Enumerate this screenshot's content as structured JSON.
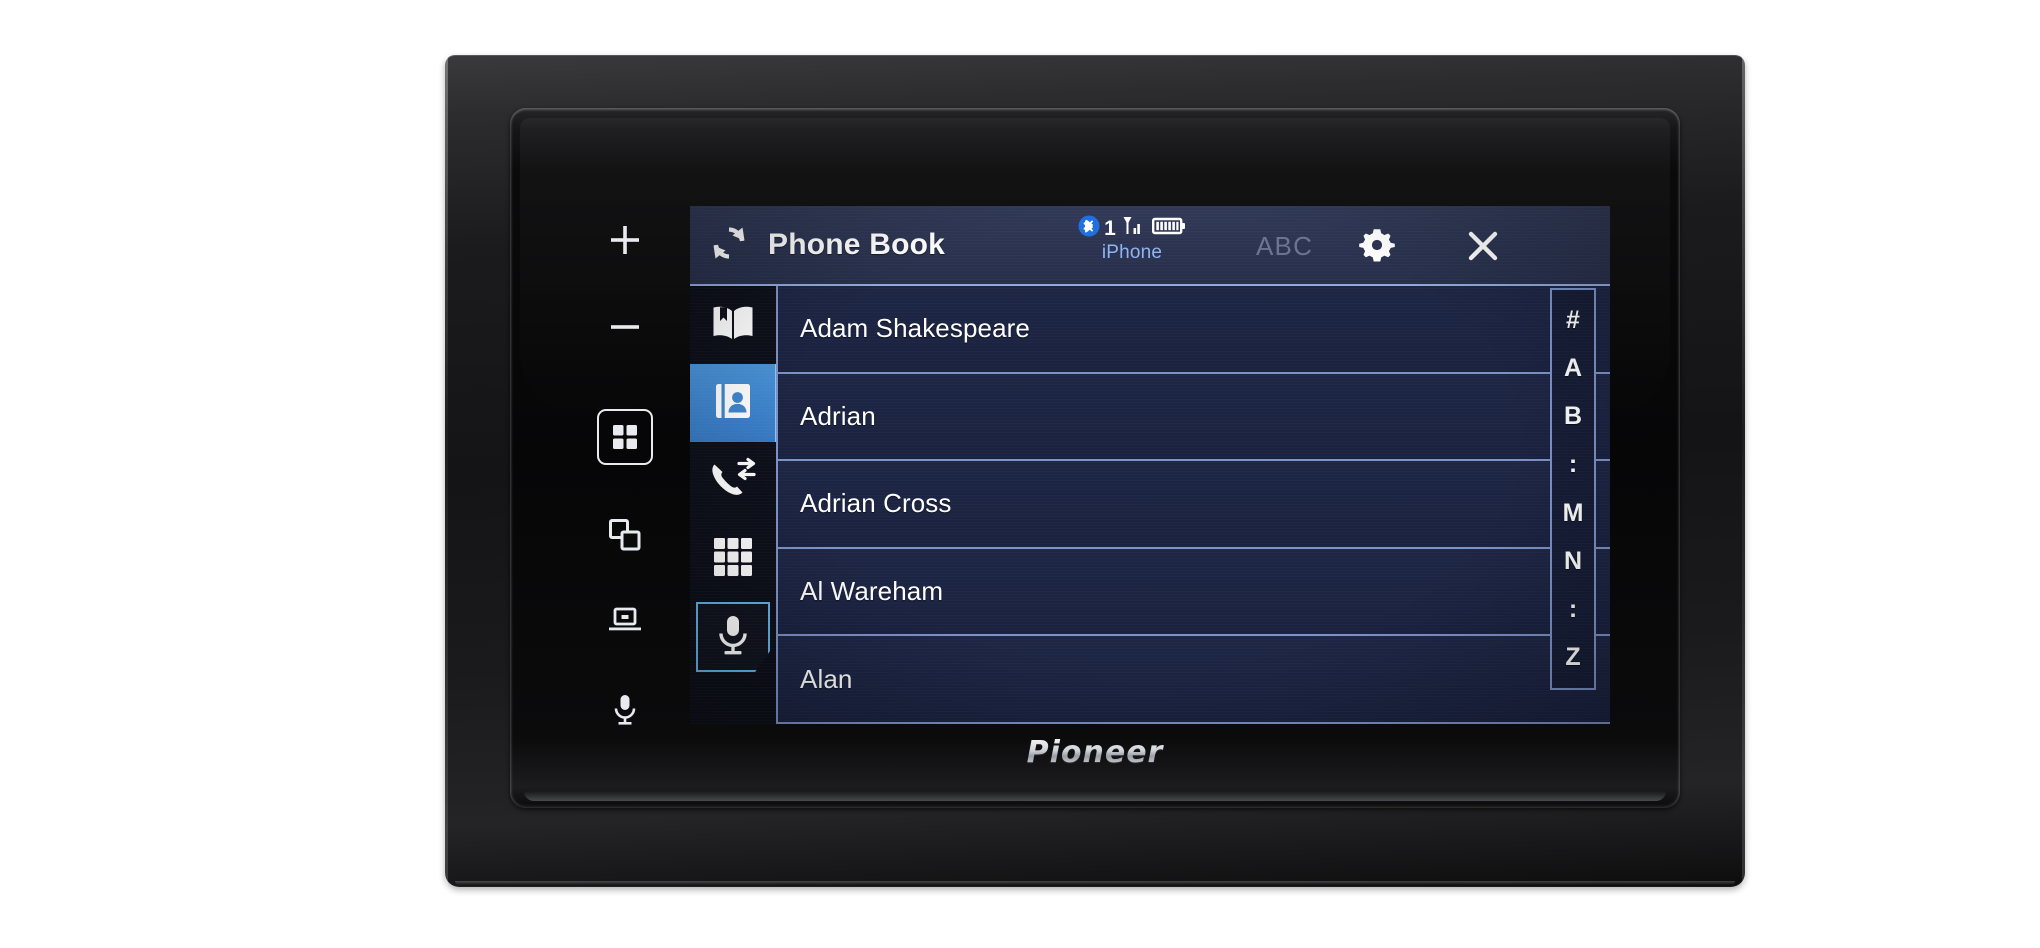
{
  "device": {
    "brand": "Pioneer",
    "hardware_keys": [
      {
        "name": "volume-up",
        "glyph": "plus"
      },
      {
        "name": "volume-down",
        "glyph": "minus"
      },
      {
        "name": "home",
        "glyph": "four-squares-box"
      },
      {
        "name": "app-switch",
        "glyph": "two-overlapping-squares"
      },
      {
        "name": "display-off",
        "glyph": "screen"
      },
      {
        "name": "voice-control",
        "glyph": "microphone"
      }
    ]
  },
  "colors": {
    "accent_blue": "#3f86cf",
    "accent_light": "#8fc8f0",
    "header_bg": "#2b3350",
    "list_bg": "#1b2340",
    "divider": "#7d93c6",
    "device_name": "#8fb4f2",
    "abc_dim": "#6a7390"
  },
  "header": {
    "refresh_icon": "refresh-icon",
    "title": "Phone Book",
    "status": {
      "bluetooth_icon": "bluetooth-icon",
      "bluetooth_count": "1",
      "signal_icon": "signal-bars-icon",
      "battery_icon": "battery-full-icon",
      "device_name": "iPhone"
    },
    "sort_label": "ABC",
    "settings_icon": "gear-icon",
    "close_icon": "close-icon"
  },
  "sidebar": {
    "items": [
      {
        "name": "speed-dial",
        "icon": "open-book-icon",
        "active": false,
        "outlined": false
      },
      {
        "name": "phone-book",
        "icon": "contact-book-icon",
        "active": true,
        "outlined": false
      },
      {
        "name": "call-history",
        "icon": "call-history-icon",
        "active": false,
        "outlined": false
      },
      {
        "name": "keypad",
        "icon": "keypad-grid-icon",
        "active": false,
        "outlined": false
      },
      {
        "name": "voice-dial",
        "icon": "microphone-icon",
        "active": false,
        "outlined": true
      }
    ]
  },
  "contacts": {
    "rows": [
      {
        "name": "Adam Shakespeare"
      },
      {
        "name": "Adrian"
      },
      {
        "name": "Adrian Cross"
      },
      {
        "name": "Al Wareham"
      },
      {
        "name": "Alan"
      }
    ]
  },
  "alphabet_index": {
    "items": [
      "#",
      "A",
      "B",
      ":",
      "M",
      "N",
      ":",
      "Z"
    ]
  }
}
